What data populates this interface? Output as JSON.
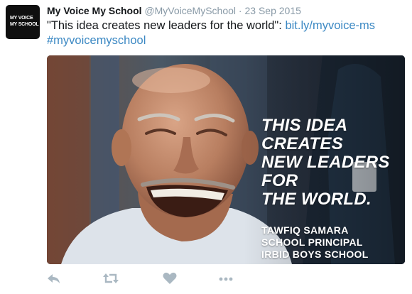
{
  "author": {
    "avatar_lines": [
      "MY VOICE",
      "MY SCHOOL"
    ],
    "name": "My Voice My School",
    "handle": "@MyVoiceMySchool",
    "separator": "·",
    "date": "23 Sep 2015"
  },
  "tweet": {
    "quote": "\"This idea creates new leaders for the world\":",
    "link": "bit.ly/myvoice-ms",
    "hashtag": "#myvoicemyschool"
  },
  "media": {
    "headline_lines": [
      "THIS IDEA CREATES",
      "NEW LEADERS FOR",
      "THE WORLD."
    ],
    "credit_lines": [
      "TAWFIQ SAMARA",
      "SCHOOL PRINCIPAL",
      "IRBID BOYS SCHOOL"
    ]
  },
  "actions": [
    {
      "icon": "reply-icon"
    },
    {
      "icon": "retweet-icon"
    },
    {
      "icon": "like-icon"
    },
    {
      "icon": "more-icon"
    }
  ],
  "colors": {
    "link": "#3b88c3",
    "muted": "#8899a6",
    "icon": "#aab8c2"
  }
}
